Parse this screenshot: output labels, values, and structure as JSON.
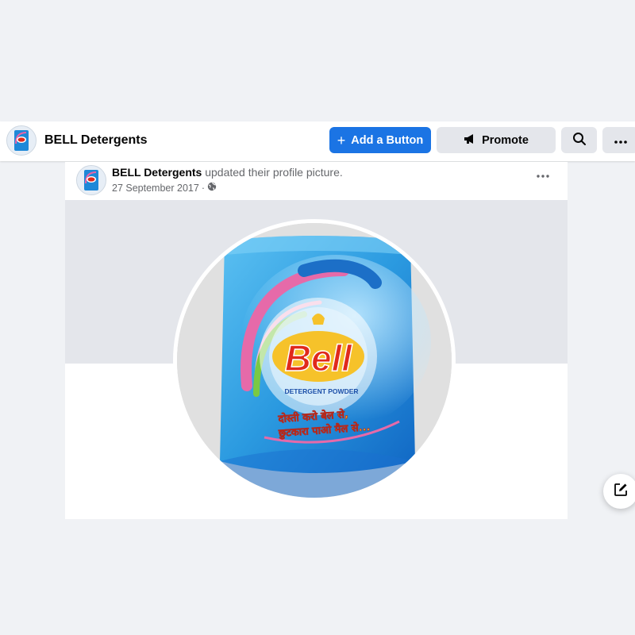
{
  "page_bar": {
    "page_name": "BELL Detergents",
    "add_button_label": "Add a Button",
    "promote_label": "Promote"
  },
  "post": {
    "author": "BELL Detergents",
    "action": " updated their profile picture.",
    "date": "27 September 2017",
    "date_separator": " · ",
    "visibility_icon": "globe-icon"
  },
  "product_image": {
    "brand": "Bell",
    "product_type": "DETERGENT POWDER",
    "tagline_line1": "दोस्ती करो बेल से,",
    "tagline_line2": "छुटकारा पाओ मैल से...",
    "colors": {
      "pack": "#1e88d8",
      "pack_light": "#52b8ee",
      "brand_red": "#e02a1c",
      "brand_yellow": "#f6c22a"
    }
  },
  "icons": {
    "plus": "plus-icon",
    "megaphone": "megaphone-icon",
    "search": "search-icon",
    "more": "more-horizontal-icon",
    "compose": "compose-icon"
  },
  "colors": {
    "primary": "#1b74e4",
    "secondary_button": "#e4e6eb",
    "page_background": "#f0f2f5"
  }
}
